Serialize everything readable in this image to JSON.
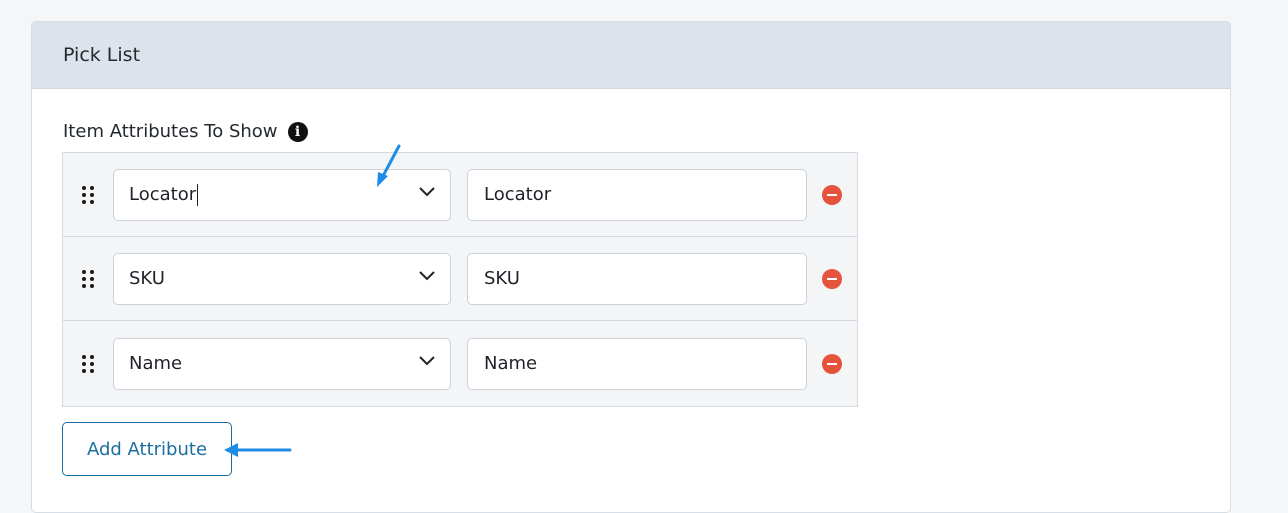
{
  "panel": {
    "title": "Pick List"
  },
  "attributes_section": {
    "label": "Item Attributes To Show",
    "info_icon": "info-icon",
    "rows": [
      {
        "attribute": "Locator",
        "display_label": "Locator"
      },
      {
        "attribute": "SKU",
        "display_label": "SKU"
      },
      {
        "attribute": "Name",
        "display_label": "Name"
      }
    ],
    "add_button_label": "Add Attribute"
  },
  "colors": {
    "accent": "#1b6fa0",
    "remove": "#e5533d",
    "annotation_arrow": "#1f8ce6",
    "header_bg": "#dde3ea"
  }
}
